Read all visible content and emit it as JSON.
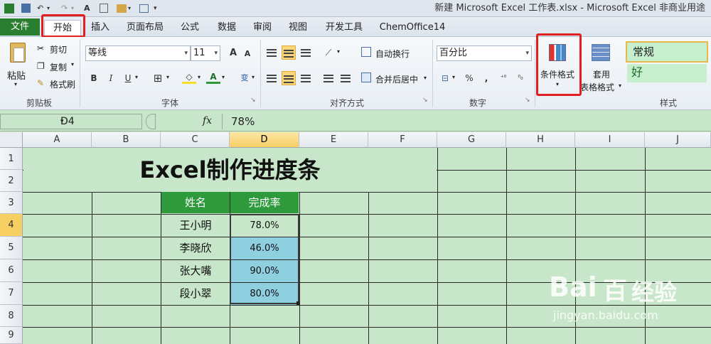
{
  "window": {
    "title": "新建 Microsoft Excel 工作表.xlsx - Microsoft Excel 非商业用途"
  },
  "quick_access": {
    "undo_icon": "undo-icon",
    "redo_icon": "redo-icon"
  },
  "tabs": [
    {
      "label": "文件"
    },
    {
      "label": "开始"
    },
    {
      "label": "插入"
    },
    {
      "label": "页面布局"
    },
    {
      "label": "公式"
    },
    {
      "label": "数据"
    },
    {
      "label": "审阅"
    },
    {
      "label": "视图"
    },
    {
      "label": "开发工具"
    },
    {
      "label": "ChemOffice14"
    }
  ],
  "ribbon": {
    "clipboard": {
      "group": "剪贴板",
      "paste": "粘贴",
      "cut": "剪切",
      "copy": "复制",
      "format_painter": "格式刷"
    },
    "font": {
      "group": "字体",
      "family": "等线",
      "size": "11",
      "bold": "B",
      "italic": "I",
      "underline": "U",
      "grow": "A",
      "shrink": "A",
      "font_color": "A",
      "phonetic": "变"
    },
    "alignment": {
      "group": "对齐方式",
      "wrap": "自动换行",
      "merge": "合并后居中"
    },
    "number": {
      "group": "数字",
      "format": "百分比",
      "percent": "%",
      "comma": ","
    },
    "styles": {
      "group": "样式",
      "conditional": "条件格式",
      "table_format_1": "套用",
      "table_format_2": "表格格式",
      "normal": "常规",
      "good": "好"
    }
  },
  "formula_bar": {
    "name_box": "D4",
    "fx": "fx",
    "value": "78%"
  },
  "sheet": {
    "columns": [
      "A",
      "B",
      "C",
      "D",
      "E",
      "F",
      "G",
      "H",
      "I",
      "J"
    ],
    "rows": [
      "1",
      "2",
      "3",
      "4",
      "5",
      "6",
      "7",
      "8",
      "9"
    ],
    "active_column": "D",
    "active_row": "4",
    "title": "Excel制作进度条",
    "header_name": "姓名",
    "header_rate": "完成率",
    "people": [
      {
        "name": "王小明",
        "rate": "78.0%",
        "value": 0.78
      },
      {
        "name": "李晓欣",
        "rate": "46.0%",
        "value": 0.46
      },
      {
        "name": "张大嘴",
        "rate": "90.0%",
        "value": 0.9
      },
      {
        "name": "段小翠",
        "rate": "80.0%",
        "value": 0.8
      }
    ]
  },
  "colors": {
    "sheet_bg": "#c8e6c9",
    "header_green": "#2e9a3c",
    "bar_blue": "#8ecfe0",
    "highlight_red": "#e02020"
  },
  "watermark": {
    "brand": "Bai",
    "brand2": "百",
    "brand3": "经验",
    "url": "jingyan.baidu.com"
  }
}
